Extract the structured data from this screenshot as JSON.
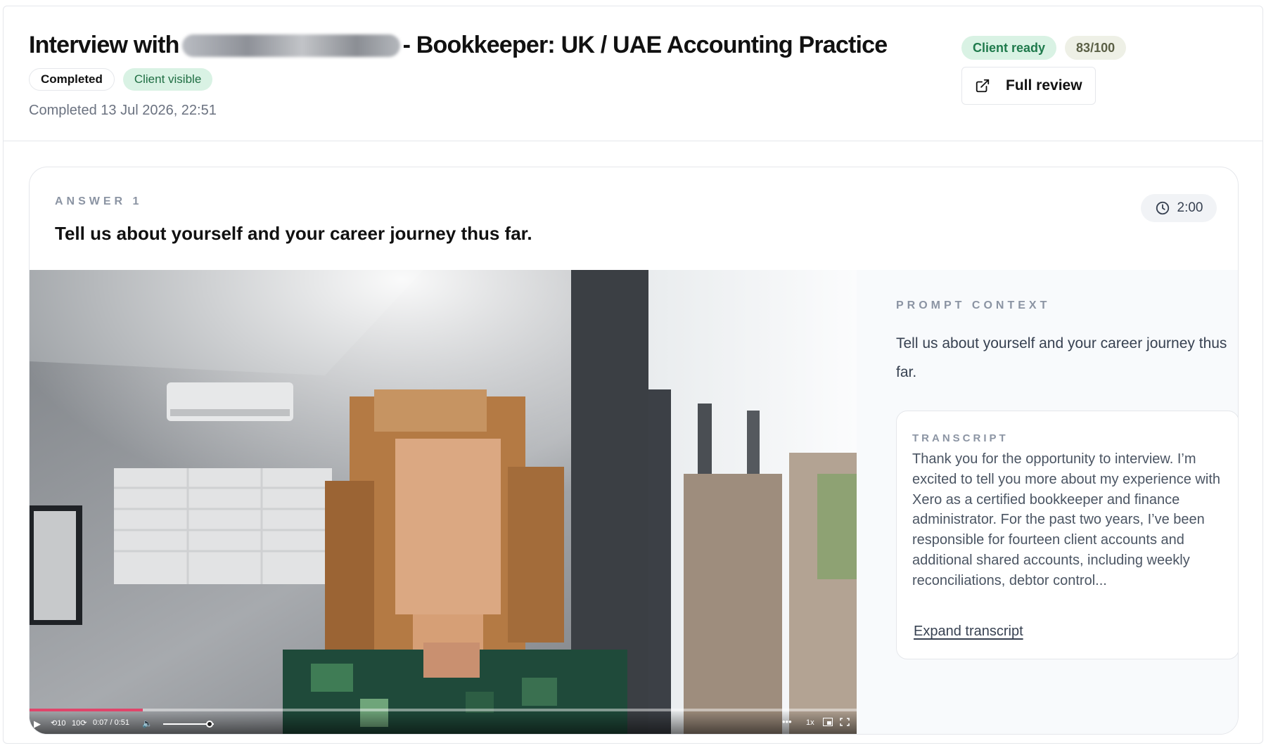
{
  "header": {
    "title_prefix": "Interview with",
    "title_suffix": "- Bookkeeper: UK / UAE Accounting Practice",
    "badges": [
      "Completed",
      "Client visible"
    ],
    "completed_text": "Completed 13 Jul 2026, 22:51",
    "status_pill": "Client ready",
    "score": "83/100",
    "full_review_label": "Full review"
  },
  "answer": {
    "label": "ANSWER 1",
    "question": "Tell us about yourself and your career journey thus far.",
    "duration": "2:00"
  },
  "video": {
    "time_display": "0:07 / 0:51",
    "rewind_label": "10",
    "forward_label": "10",
    "speed_label": "1x",
    "progress_fraction": 0.137,
    "volume_fraction": 0.92
  },
  "side": {
    "prompt_label": "PROMPT CONTEXT",
    "prompt_text": "Tell us about yourself and your career journey thus far.",
    "transcript_label": "TRANSCRIPT",
    "transcript_text": "Thank you for the opportunity to interview. I’m excited to tell you more about my experience with Xero as a certified bookkeeper and finance administrator. For the past two years, I’ve been responsible for fourteen client accounts and additional shared accounts, including weekly reconciliations, debtor control...",
    "expand_label": "Expand transcript"
  },
  "colors": {
    "accent_green_bg": "#d9f2e4",
    "accent_green_text": "#1f7a4c",
    "progress": "#e0456a"
  }
}
